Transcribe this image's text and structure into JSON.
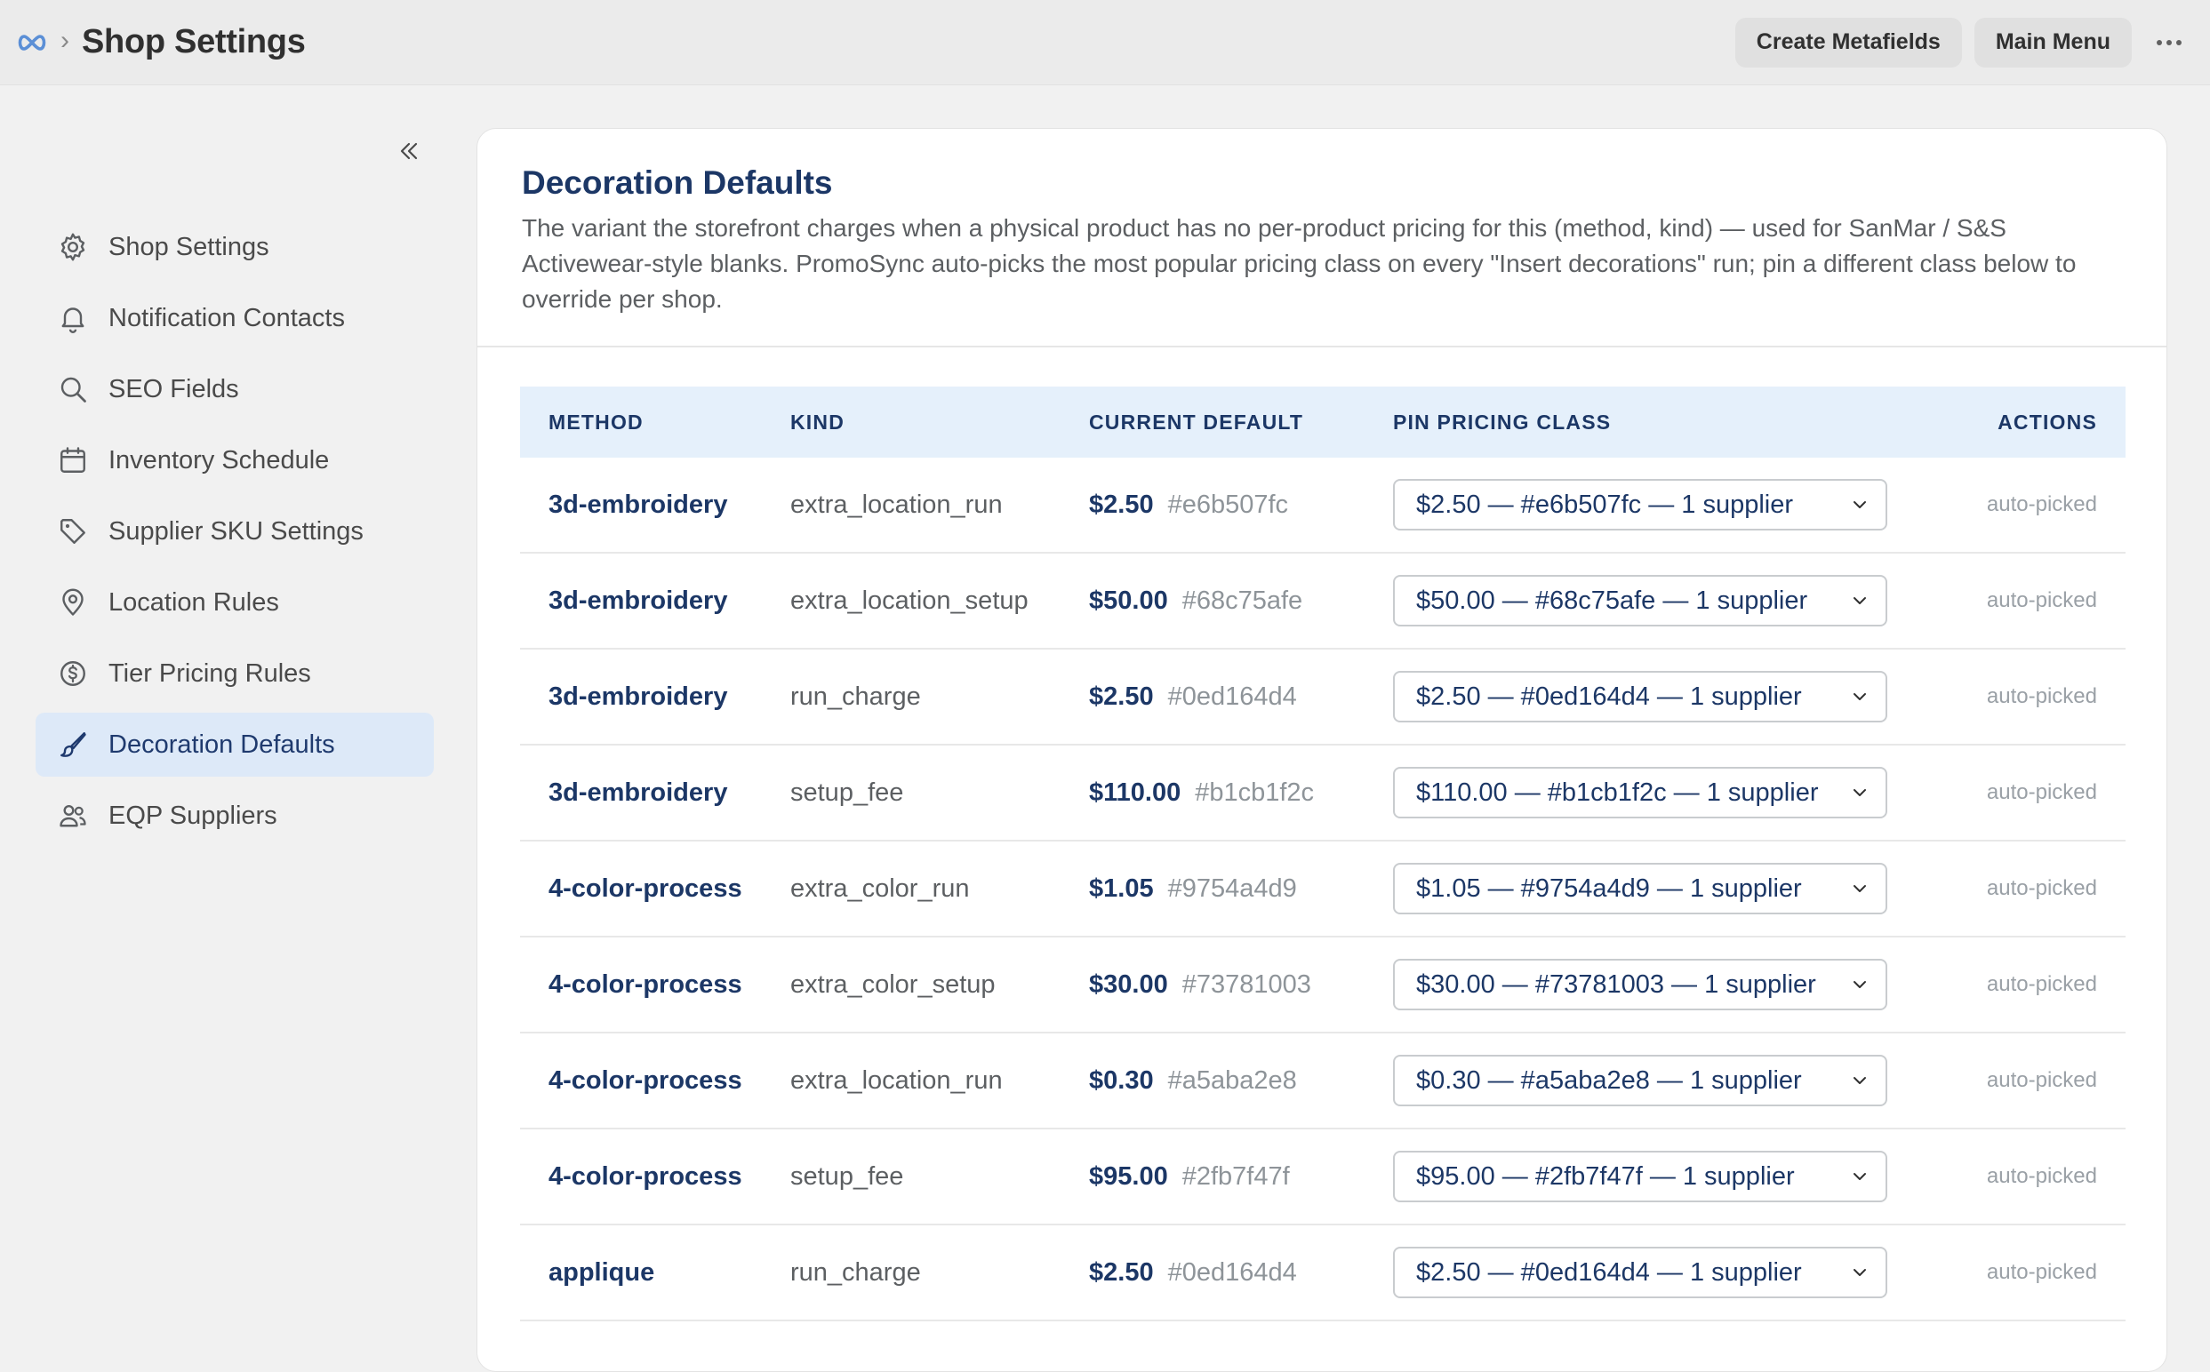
{
  "topbar": {
    "logo_icon": "infinity-icon",
    "breadcrumb_separator": "›",
    "title": "Shop Settings",
    "create_metafields_label": "Create Metafields",
    "main_menu_label": "Main Menu",
    "more_icon": "ellipsis-icon"
  },
  "sidebar": {
    "collapse_icon": "double-chevron-left-icon",
    "items": [
      {
        "label": "Shop Settings",
        "icon": "gear-icon",
        "active": false
      },
      {
        "label": "Notification Contacts",
        "icon": "bell-icon",
        "active": false
      },
      {
        "label": "SEO Fields",
        "icon": "search-icon",
        "active": false
      },
      {
        "label": "Inventory Schedule",
        "icon": "calendar-icon",
        "active": false
      },
      {
        "label": "Supplier SKU Settings",
        "icon": "tag-icon",
        "active": false
      },
      {
        "label": "Location Rules",
        "icon": "location-pin-icon",
        "active": false
      },
      {
        "label": "Tier Pricing Rules",
        "icon": "dollar-circle-icon",
        "active": false
      },
      {
        "label": "Decoration Defaults",
        "icon": "paintbrush-icon",
        "active": true
      },
      {
        "label": "EQP Suppliers",
        "icon": "users-icon",
        "active": false
      }
    ]
  },
  "card": {
    "title": "Decoration Defaults",
    "description": "The variant the storefront charges when a physical product has no per-product pricing for this (method, kind) — used for SanMar / S&S Activewear-style blanks. PromoSync auto-picks the most popular pricing class on every \"Insert decorations\" run; pin a different class below to override per shop."
  },
  "table": {
    "headers": {
      "method": "METHOD",
      "kind": "KIND",
      "current_default": "CURRENT DEFAULT",
      "pin_pricing_class": "PIN PRICING CLASS",
      "actions": "ACTIONS"
    },
    "rows": [
      {
        "method": "3d-embroidery",
        "kind": "extra_location_run",
        "price": "$2.50",
        "hash": "#e6b507fc",
        "pin": "$2.50 — #e6b507fc — 1 supplier",
        "action": "auto-picked"
      },
      {
        "method": "3d-embroidery",
        "kind": "extra_location_setup",
        "price": "$50.00",
        "hash": "#68c75afe",
        "pin": "$50.00 — #68c75afe — 1 supplier",
        "action": "auto-picked"
      },
      {
        "method": "3d-embroidery",
        "kind": "run_charge",
        "price": "$2.50",
        "hash": "#0ed164d4",
        "pin": "$2.50 — #0ed164d4 — 1 supplier",
        "action": "auto-picked"
      },
      {
        "method": "3d-embroidery",
        "kind": "setup_fee",
        "price": "$110.00",
        "hash": "#b1cb1f2c",
        "pin": "$110.00 — #b1cb1f2c — 1 supplier",
        "action": "auto-picked"
      },
      {
        "method": "4-color-process",
        "kind": "extra_color_run",
        "price": "$1.05",
        "hash": "#9754a4d9",
        "pin": "$1.05 — #9754a4d9 — 1 supplier",
        "action": "auto-picked"
      },
      {
        "method": "4-color-process",
        "kind": "extra_color_setup",
        "price": "$30.00",
        "hash": "#73781003",
        "pin": "$30.00 — #73781003 — 1 supplier",
        "action": "auto-picked"
      },
      {
        "method": "4-color-process",
        "kind": "extra_location_run",
        "price": "$0.30",
        "hash": "#a5aba2e8",
        "pin": "$0.30 — #a5aba2e8 — 1 supplier",
        "action": "auto-picked"
      },
      {
        "method": "4-color-process",
        "kind": "setup_fee",
        "price": "$95.00",
        "hash": "#2fb7f47f",
        "pin": "$95.00 — #2fb7f47f — 1 supplier",
        "action": "auto-picked"
      },
      {
        "method": "applique",
        "kind": "run_charge",
        "price": "$2.50",
        "hash": "#0ed164d4",
        "pin": "$2.50 — #0ed164d4 — 1 supplier",
        "action": "auto-picked"
      }
    ]
  },
  "colors": {
    "accent_navy": "#1c3766",
    "active_nav_bg": "#dde9f8",
    "header_bg": "#e5f0fb",
    "logo_blue": "#5b8fd6"
  }
}
